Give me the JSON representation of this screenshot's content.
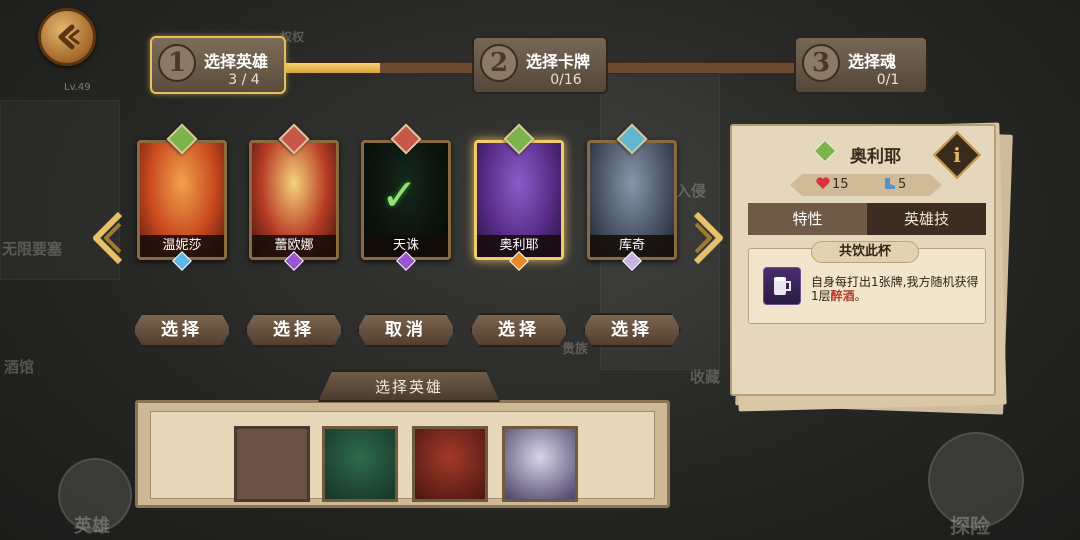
{
  "header": {
    "back_label": "back",
    "level": "Lv.49",
    "faded_top_text": "权权"
  },
  "steps": [
    {
      "num": "1",
      "title": "选择英雄",
      "count": "3 / 4",
      "active": true,
      "progress": 0.5
    },
    {
      "num": "2",
      "title": "选择卡牌",
      "count": "0/16",
      "active": false,
      "progress": 0
    },
    {
      "num": "3",
      "title": "选择魂",
      "count": "0/1",
      "active": false
    }
  ],
  "heroes": [
    {
      "name": "温妮莎",
      "class_color": "#7cb34a",
      "gem_color": "#5fb8e8",
      "button": "选择",
      "portrait": [
        "#f0a24a",
        "#c94a1f",
        "#5a1b10"
      ],
      "state": "normal"
    },
    {
      "name": "蕾欧娜",
      "class_color": "#c8574a",
      "gem_color": "#9a55d0",
      "button": "选择",
      "portrait": [
        "#f5d27a",
        "#b83c25",
        "#3b1410"
      ],
      "state": "normal"
    },
    {
      "name": "天诛",
      "class_color": "#c8574a",
      "gem_color": "#9a55d0",
      "button": "取消",
      "portrait": [
        "#2d5a3a",
        "#1b2b20",
        "#0d1510"
      ],
      "state": "picked"
    },
    {
      "name": "奥利耶",
      "class_color": "#7cb34a",
      "gem_color": "#e88a2a",
      "button": "选择",
      "portrait": [
        "#8b5cc9",
        "#5a2d8a",
        "#241238"
      ],
      "state": "selected"
    },
    {
      "name": "库奇",
      "class_color": "#5fb8d0",
      "gem_color": "#c9b2e2",
      "button": "选择",
      "portrait": [
        "#8a96a8",
        "#4a5566",
        "#1e232b"
      ],
      "state": "normal"
    }
  ],
  "detail": {
    "name": "奥利耶",
    "info_label": "i",
    "hp": "15",
    "stat2": "5",
    "tabs": [
      "特性",
      "英雄技"
    ],
    "skill": {
      "title": "共饮此杯",
      "desc_prefix": "自身每打出1张牌,我方随机获得1层",
      "desc_highlight": "醉酒",
      "desc_suffix": "。"
    }
  },
  "bottom": {
    "title": "选择英雄",
    "slots": [
      {
        "empty": true
      },
      {
        "empty": false,
        "colors": [
          "#2e6b4a",
          "#163427"
        ]
      },
      {
        "empty": false,
        "colors": [
          "#a33a2a",
          "#4a1610"
        ]
      },
      {
        "empty": false,
        "colors": [
          "#d8d6e8",
          "#4a4066"
        ]
      }
    ]
  },
  "background": {
    "labels": [
      "无限要塞",
      "酒馆",
      "入侵",
      "贵族",
      "收藏",
      "英雄",
      "探险"
    ]
  },
  "colors": {
    "accent_gold": "#e8bf5c",
    "panel_parchment": "#e5d7bb"
  }
}
